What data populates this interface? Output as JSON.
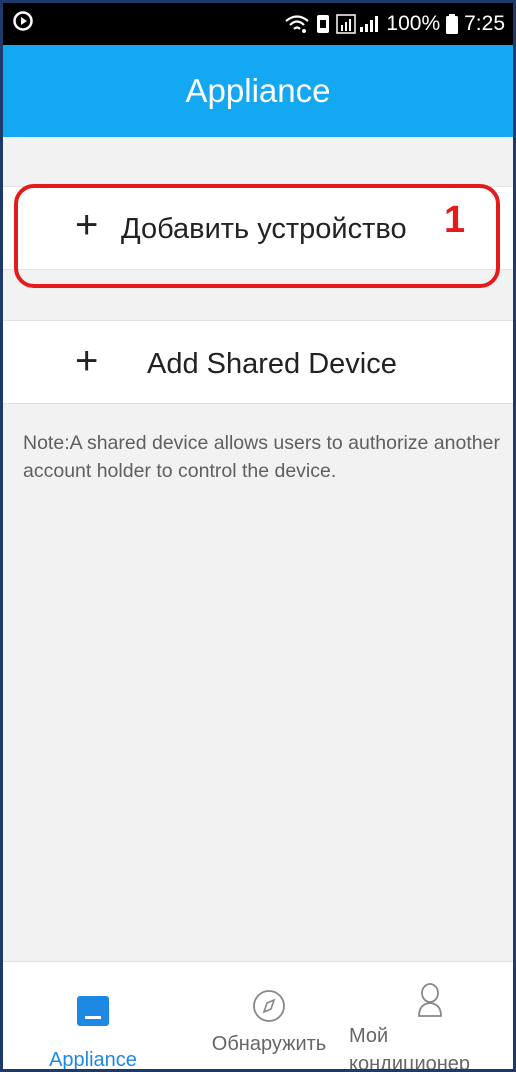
{
  "status_bar": {
    "battery": "100%",
    "time": "7:25",
    "icons": [
      "media-icon",
      "wifi-icon",
      "sim-icon",
      "signal-icon",
      "battery-icon"
    ]
  },
  "header": {
    "title": "Appliance"
  },
  "add_device": {
    "label": "Добавить устройство",
    "icon": "plus-icon"
  },
  "shared_device": {
    "label": "Add Shared Device",
    "icon": "plus-icon"
  },
  "note": "Note:A shared device allows users to authorize another account holder to control the device.",
  "callout": {
    "number": "1",
    "color": "#e31b1b"
  },
  "bottom_nav": {
    "items": [
      {
        "label": "Appliance",
        "icon": "appliance-icon",
        "active": true
      },
      {
        "label": "Обнаружить",
        "icon": "compass-icon",
        "active": false
      },
      {
        "label": "Мой кондиционер",
        "icon": "user-icon",
        "active": false
      }
    ]
  },
  "colors": {
    "header": "#14a8f2",
    "active_tab": "#1e88e5",
    "background": "#f2f2f2"
  }
}
